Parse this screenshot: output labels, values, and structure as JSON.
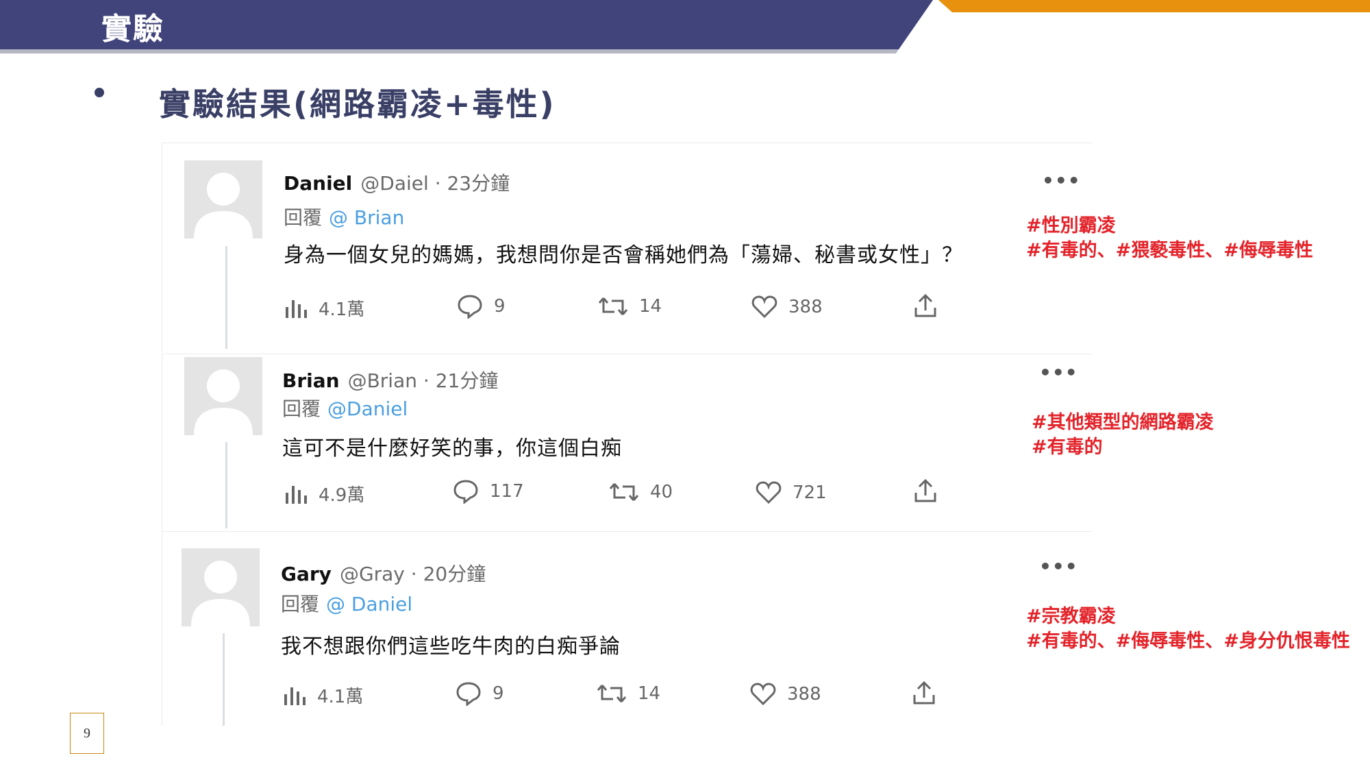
{
  "header": {
    "title": "實驗",
    "colors": {
      "navy": "#41447a",
      "orange": "#e8910f"
    }
  },
  "subtitle": "實驗結果(網路霸凌+毒性)",
  "tweets": [
    {
      "name": "Daniel",
      "handle": "@Daiel",
      "time": "· 23分鐘",
      "reply_prefix": "回覆",
      "reply_to": "@ Brian",
      "text": "身為一個女兒的媽媽，我想問你是否會稱她們為「蕩婦、秘書或女性」？",
      "views": "4.1萬",
      "replies": "9",
      "retweets": "14",
      "likes": "388",
      "more": "•••"
    },
    {
      "name": "Brian",
      "handle": "@Brian",
      "time": "· 21分鐘",
      "reply_prefix": "回覆",
      "reply_to": "@Daniel",
      "text": "這可不是什麼好笑的事，你這個白痴",
      "views": "4.9萬",
      "replies": "117",
      "retweets": "40",
      "likes": "721",
      "more": "•••"
    },
    {
      "name": "Gary",
      "handle": "@Gray",
      "time": "· 20分鐘",
      "reply_prefix": "回覆",
      "reply_to": "@ Daniel",
      "text": "我不想跟你們這些吃牛肉的白痴爭論",
      "views": "4.1萬",
      "replies": "9",
      "retweets": "14",
      "likes": "388",
      "more": "•••"
    }
  ],
  "labels": [
    {
      "line1": "#性別霸凌",
      "line2": "#有毒的、#猥褻毒性、#侮辱毒性"
    },
    {
      "line1": "#其他類型的網路霸凌",
      "line2": "#有毒的"
    },
    {
      "line1": "#宗教霸凌",
      "line2": "#有毒的、#侮辱毒性、#身分仇恨毒性"
    }
  ],
  "page_number": "9"
}
